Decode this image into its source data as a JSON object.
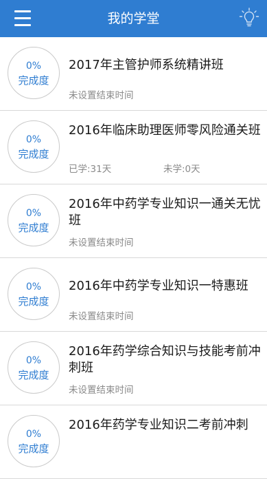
{
  "header": {
    "title": "我的学堂",
    "menu_icon": "hamburger-menu-icon",
    "right_icon": "lightbulb-icon",
    "background": "#2f7dd1"
  },
  "progress_label": "完成度",
  "courses": [
    {
      "progress": "0%",
      "title": "2017年主管护师系统精讲班",
      "meta_left": "未设置结束时间",
      "meta_right": ""
    },
    {
      "progress": "0%",
      "title": "2016年临床助理医师零风险通关班",
      "meta_left": "已学:31天",
      "meta_right": "未学:0天"
    },
    {
      "progress": "0%",
      "title": "2016年中药学专业知识一通关无忧班",
      "meta_left": "未设置结束时间",
      "meta_right": ""
    },
    {
      "progress": "0%",
      "title": "2016年中药学专业知识一特惠班",
      "meta_left": "未设置结束时间",
      "meta_right": ""
    },
    {
      "progress": "0%",
      "title": "2016年药学综合知识与技能考前冲刺班",
      "meta_left": "未设置结束时间",
      "meta_right": ""
    },
    {
      "progress": "0%",
      "title": "2016年药学专业知识二考前冲刺",
      "meta_left": "",
      "meta_right": ""
    }
  ]
}
